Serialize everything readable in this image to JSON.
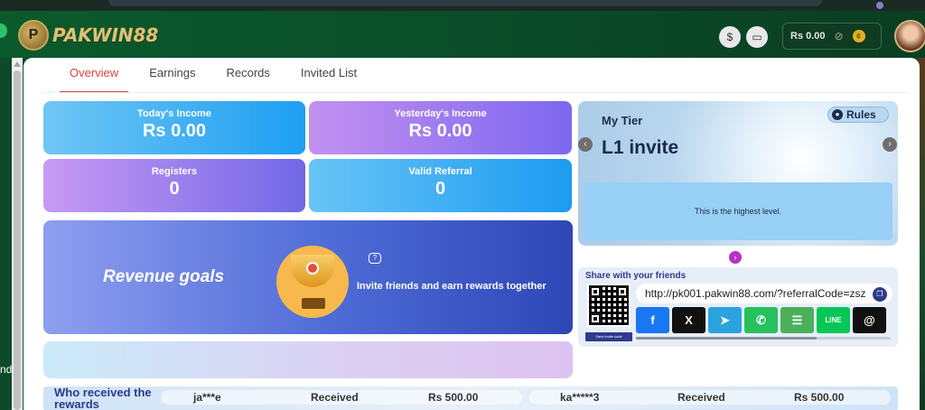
{
  "header": {
    "logo_text": "PAKWIN88",
    "balance": "Rs 0.00",
    "icons": [
      "money-bag-icon",
      "chat-support-icon",
      "eye-slash-icon",
      "coin-icon"
    ]
  },
  "left_rail": {
    "partial_text": "nd"
  },
  "tabs": [
    {
      "label": "Overview",
      "active": true
    },
    {
      "label": "Earnings",
      "active": false
    },
    {
      "label": "Records",
      "active": false
    },
    {
      "label": "Invited List",
      "active": false
    }
  ],
  "stats": {
    "today_income": {
      "label": "Today's Income",
      "value": "Rs 0.00"
    },
    "yesterday_income": {
      "label": "Yesterday's Income",
      "value": "Rs 0.00"
    },
    "registers": {
      "label": "Registers",
      "value": "0"
    },
    "valid_referral": {
      "label": "Valid Referral",
      "value": "0"
    }
  },
  "revenue_goals": {
    "title": "Revenue goals",
    "invite_text": "Invite friends and earn rewards together"
  },
  "tier": {
    "title": "My Tier",
    "level": "L1 invite",
    "rules_label": "Rules",
    "message": "This is the highest level."
  },
  "share": {
    "title": "Share with your friends",
    "url": "http://pk001.pakwin88.com/?referralCode=zsz",
    "save_label": "Save invite code",
    "platforms": [
      {
        "name": "facebook",
        "glyph": "f",
        "color": "#1877f2"
      },
      {
        "name": "x",
        "glyph": "𝕏",
        "color": "#111111"
      },
      {
        "name": "telegram",
        "glyph": "➤",
        "color": "#2aa3de"
      },
      {
        "name": "whatsapp",
        "glyph": "✆",
        "color": "#25c15c"
      },
      {
        "name": "sms",
        "glyph": "☰",
        "color": "#4cb05a"
      },
      {
        "name": "line",
        "glyph": "LINE",
        "color": "#06c755"
      },
      {
        "name": "threads",
        "glyph": "@",
        "color": "#111111"
      }
    ]
  },
  "rewards": {
    "title_line1": "Who received the",
    "title_line2": "rewards",
    "entries": [
      {
        "user": "ja***e",
        "status": "Received",
        "amount": "Rs 500.00"
      },
      {
        "user": "ka*****3",
        "status": "Received",
        "amount": "Rs 500.00"
      }
    ]
  }
}
